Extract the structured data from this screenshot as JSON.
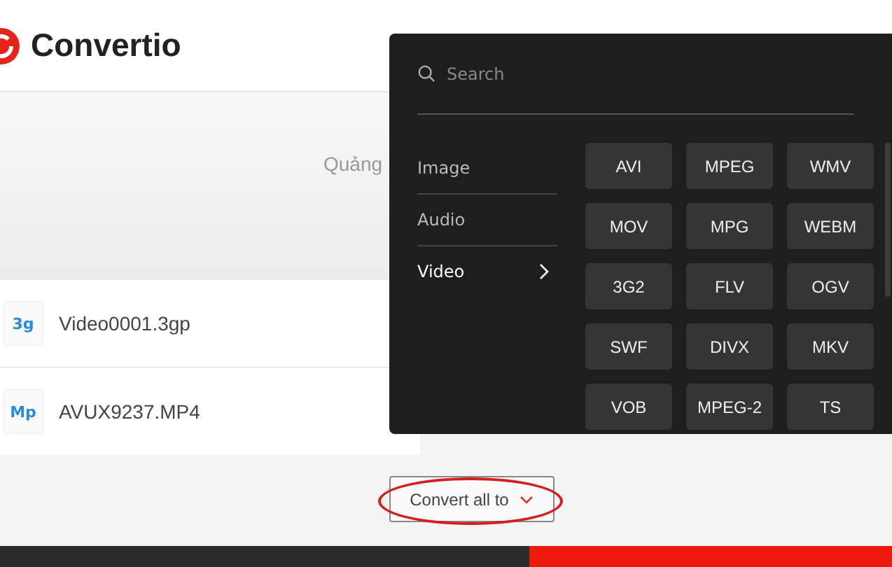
{
  "header": {
    "logo_text": "Convertio"
  },
  "banner": {
    "text": "Quảng"
  },
  "files": [
    {
      "badge": "3g",
      "name": "Video0001.3gp"
    },
    {
      "badge": "Mp",
      "name": "AVUX9237.MP4"
    }
  ],
  "convert_button": {
    "label": "Convert all to",
    "highlighted": true
  },
  "format_menu": {
    "search": {
      "placeholder": "Search"
    },
    "categories": [
      {
        "label": "Image",
        "selected": false
      },
      {
        "label": "Audio",
        "selected": false
      },
      {
        "label": "Video",
        "selected": true
      }
    ],
    "formats": [
      "AVI",
      "MPEG",
      "WMV",
      "MOV",
      "MPG",
      "WEBM",
      "3G2",
      "FLV",
      "OGV",
      "SWF",
      "DIVX",
      "MKV",
      "VOB",
      "MPEG-2",
      "TS"
    ]
  }
}
